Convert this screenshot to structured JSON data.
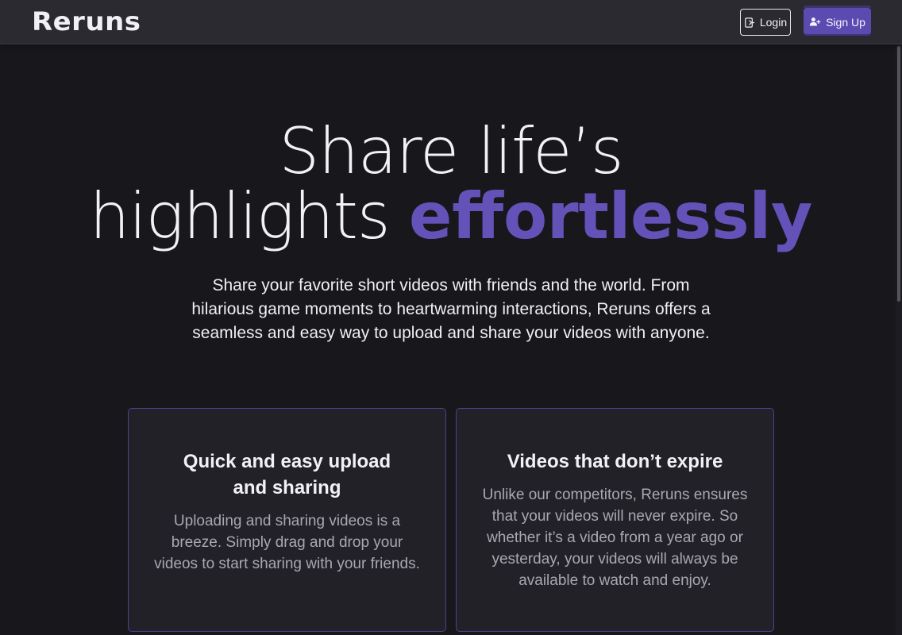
{
  "navbar": {
    "logo": "Reruns",
    "login_label": "Login",
    "signup_label": "Sign Up"
  },
  "hero": {
    "title_line1": "Share life’s",
    "title_line2_plain": "highlights ",
    "title_line2_accent": "effortlessly",
    "subtitle": "Share your favorite short videos with friends and the world. From hilarious game moments to heartwarming interactions, Reruns offers a seamless and easy way to upload and share your videos with anyone."
  },
  "features": [
    {
      "title": "Quick and easy upload and sharing",
      "text": "Uploading and sharing videos is a breeze. Simply drag and drop your videos to start sharing with your friends."
    },
    {
      "title": "Videos that don’t expire",
      "text": "Unlike our competitors, Reruns ensures that your videos will never expire. So whether it’s a video from a year ago or yesterday, your videos will always be available to watch and enjoy."
    }
  ],
  "colors": {
    "background": "#18171c",
    "navbar": "#2b2a31",
    "accent": "#6452b8",
    "card_border": "#4b4290"
  },
  "icons": {
    "login": "login-icon",
    "signup": "user-plus-icon"
  }
}
